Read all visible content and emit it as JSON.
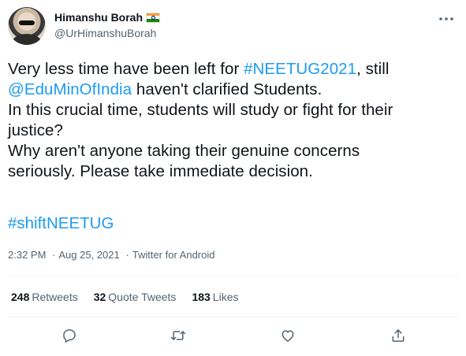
{
  "author": {
    "display_name": "Himanshu Borah",
    "handle": "@UrHimanshuBorah",
    "flag_icon": "india-flag-icon"
  },
  "tweet": {
    "line1_pre": "Very less time have been left for ",
    "line1_hashtag": "#NEETUG2021",
    "line1_post": ", still",
    "line2_mention": "@EduMinOfIndia",
    "line2_post": " haven't clarified Students.",
    "line3": "In this crucial time, students will study or fight for their",
    "line4": "justice?",
    "line5": "Why aren't anyone taking their genuine concerns",
    "line6": "seriously. Please take immediate decision.",
    "hashtag": "#shiftNEETUG"
  },
  "meta": {
    "time": "2:32 PM",
    "separator": "·",
    "date": "Aug 25, 2021",
    "source": "Twitter for Android"
  },
  "stats": {
    "retweets_count": "248",
    "retweets_label": "Retweets",
    "quotes_count": "32",
    "quotes_label": "Quote Tweets",
    "likes_count": "183",
    "likes_label": "Likes"
  },
  "colors": {
    "link": "#1d9bf0",
    "secondary_text": "#536471",
    "primary_text": "#0f1419",
    "divider": "#eff3f4"
  },
  "icons": [
    "more-icon",
    "reply-icon",
    "retweet-icon",
    "like-icon",
    "share-icon"
  ]
}
